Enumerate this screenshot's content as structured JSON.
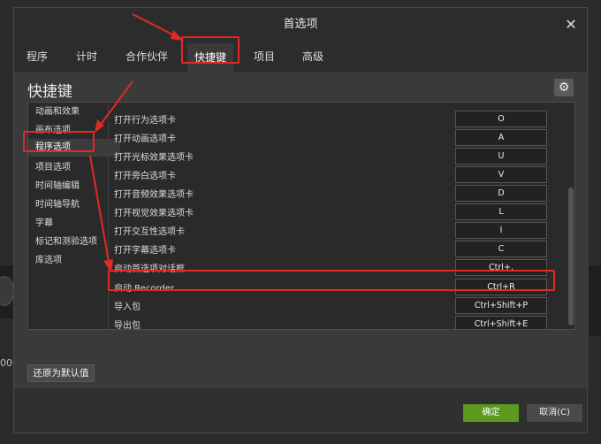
{
  "window": {
    "title": "首选项"
  },
  "tabs": [
    "程序",
    "计时",
    "合作伙伴",
    "快捷键",
    "项目",
    "高级"
  ],
  "section_title": "快捷键",
  "categories": [
    "动画和效果",
    "画布选项",
    "程序选项",
    "项目选项",
    "时间轴编辑",
    "时间轴导航",
    "字幕",
    "标记和测验选项",
    "库选项"
  ],
  "shortcuts": [
    {
      "label": "打开行为选项卡",
      "key": "O"
    },
    {
      "label": "打开动画选项卡",
      "key": "A"
    },
    {
      "label": "打开光标效果选项卡",
      "key": "U"
    },
    {
      "label": "打开旁白选项卡",
      "key": "V"
    },
    {
      "label": "打开音频效果选项卡",
      "key": "D"
    },
    {
      "label": "打开视觉效果选项卡",
      "key": "L"
    },
    {
      "label": "打开交互性选项卡",
      "key": "I"
    },
    {
      "label": "打开字幕选项卡",
      "key": "C"
    },
    {
      "label": "启动首选项对话框",
      "key": "Ctrl+,"
    },
    {
      "label": "启动 Recorder",
      "key": "Ctrl+R"
    },
    {
      "label": "导入包",
      "key": "Ctrl+Shift+P"
    },
    {
      "label": "导出包",
      "key": "Ctrl+Shift+E"
    }
  ],
  "buttons": {
    "reset": "还原为默认值",
    "ok": "确定",
    "cancel": "取消(C)"
  },
  "icons": {
    "close": "close-icon",
    "settings": "gear-icon"
  },
  "colors": {
    "ok_green": "#5b9a1f",
    "annotation_red": "#e12a26"
  }
}
